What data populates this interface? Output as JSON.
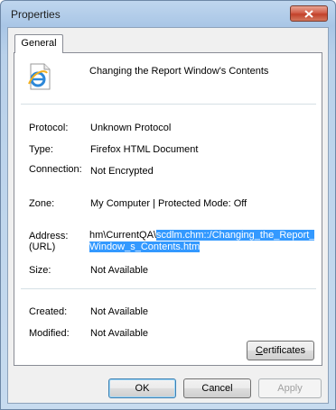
{
  "window": {
    "title": "Properties"
  },
  "tabs": [
    {
      "label": "General",
      "selected": true
    }
  ],
  "file": {
    "name": "Changing the Report Window's Contents",
    "icon": "internet-explorer-document-icon"
  },
  "properties": {
    "protocol": {
      "label": "Protocol:",
      "value": "Unknown Protocol"
    },
    "type": {
      "label": "Type:",
      "value": "Firefox HTML Document"
    },
    "connection": {
      "label": "Connection:",
      "value": "Not Encrypted"
    },
    "zone": {
      "label": "Zone:",
      "value": "My Computer | Protected Mode: Off"
    },
    "address": {
      "label_line1": "Address:",
      "label_line2": "(URL)",
      "value_prefix": "hm\\CurrentQA\\",
      "value_selected_1": "scdlm.chm::/Changing_the_Report_",
      "value_selected_2": "Window_s_Contents.htm"
    },
    "size": {
      "label": "Size:",
      "value": "Not Available"
    },
    "created": {
      "label": "Created:",
      "value": "Not Available"
    },
    "modified": {
      "label": "Modified:",
      "value": "Not Available"
    }
  },
  "buttons": {
    "certificates_first": "C",
    "certificates_rest": "ertificates",
    "ok": "OK",
    "cancel": "Cancel",
    "apply": "Apply"
  },
  "colors": {
    "selection": "#3399ff",
    "title_bar": "#b9d1ea",
    "close_button": "#c2412a"
  }
}
